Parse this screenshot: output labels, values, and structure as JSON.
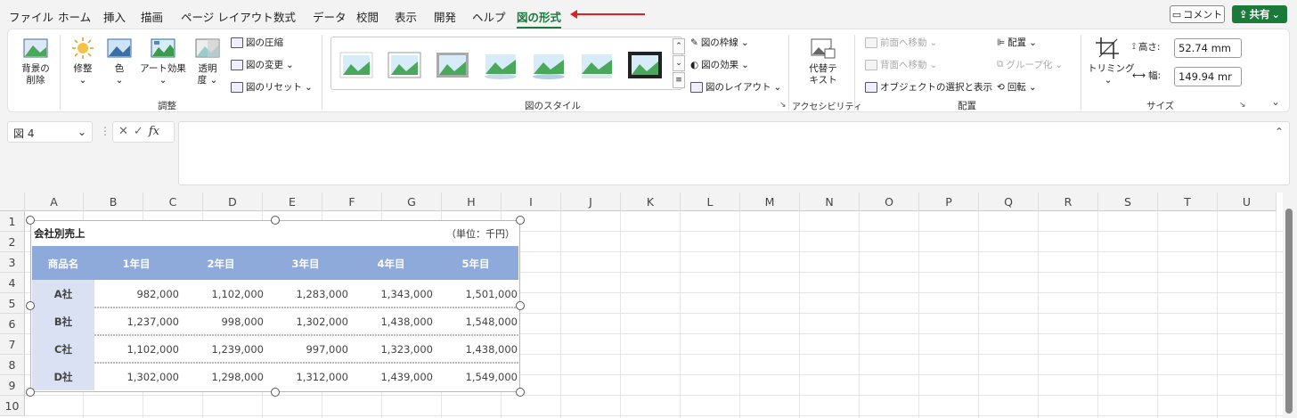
{
  "menu": {
    "items": [
      "ファイル",
      "ホーム",
      "挿入",
      "描画",
      "ページ レイアウト",
      "数式",
      "データ",
      "校閲",
      "表示",
      "開発",
      "ヘルプ",
      "図の形式"
    ],
    "active_index": 11,
    "comment": "コメント",
    "share": "共有"
  },
  "ribbon": {
    "adjust": {
      "remove_bg": [
        "背景の",
        "削除"
      ],
      "corrections": "修整",
      "color": "色",
      "artistic": "アート効果",
      "transparency": [
        "透明",
        "度"
      ],
      "compress": "図の圧縮",
      "change": "図の変更",
      "reset": "図のリセット",
      "group_label": "調整"
    },
    "styles": {
      "border": "図の枠線",
      "effects": "図の効果",
      "layout": "図のレイアウト",
      "group_label": "図のスタイル"
    },
    "accessibility": {
      "alt_text": [
        "代替テ",
        "キスト"
      ],
      "group_label": "アクセシビリティ"
    },
    "arrange": {
      "bring_forward": "前面へ移動",
      "send_backward": "背面へ移動",
      "selection_pane": "オブジェクトの選択と表示",
      "align": "配置",
      "group": "グループ化",
      "rotate": "回転",
      "group_label": "配置"
    },
    "size": {
      "crop": "トリミング",
      "height_label": "高さ:",
      "height_value": "52.74 mm",
      "width_label": "幅:",
      "width_value": "149.94 mr",
      "group_label": "サイズ"
    }
  },
  "formula_bar": {
    "name_box": "図 4",
    "fx": "fx"
  },
  "sheet": {
    "columns": [
      "A",
      "B",
      "C",
      "D",
      "E",
      "F",
      "G",
      "H",
      "I",
      "J",
      "K",
      "L",
      "M",
      "N",
      "O",
      "P",
      "Q",
      "R",
      "S",
      "T",
      "U"
    ],
    "rows": [
      "1",
      "2",
      "3",
      "4",
      "5",
      "6",
      "7",
      "8",
      "9",
      "10"
    ]
  },
  "picture": {
    "title": "会社別売上",
    "unit": "（単位：千円）",
    "headers": [
      "商品名",
      "1年目",
      "2年目",
      "3年目",
      "4年目",
      "5年目"
    ],
    "rows": [
      [
        "A社",
        "982,000",
        "1,102,000",
        "1,283,000",
        "1,343,000",
        "1,501,000"
      ],
      [
        "B社",
        "1,237,000",
        "998,000",
        "1,302,000",
        "1,438,000",
        "1,548,000"
      ],
      [
        "C社",
        "1,102,000",
        "1,239,000",
        "997,000",
        "1,323,000",
        "1,438,000"
      ],
      [
        "D社",
        "1,302,000",
        "1,298,000",
        "1,312,000",
        "1,439,000",
        "1,549,000"
      ]
    ],
    "header_color": "#8eaadb",
    "rowlabel_color": "#d9e1f2"
  },
  "colors": {
    "accent": "#1a7a3a",
    "arrow": "#e02020"
  }
}
